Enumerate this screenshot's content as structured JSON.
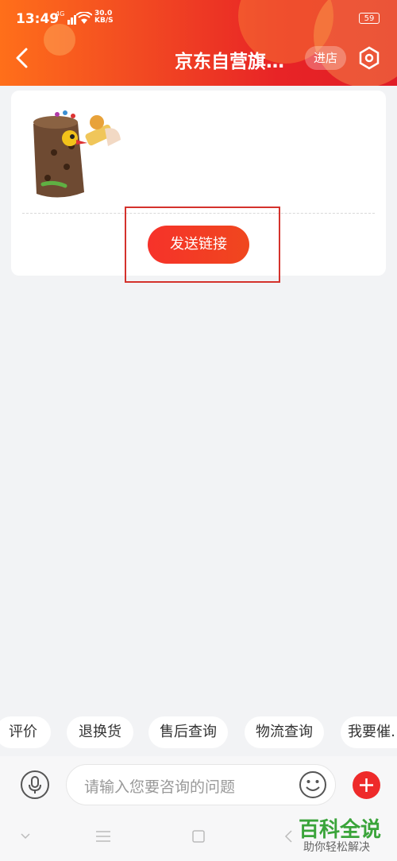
{
  "status": {
    "time": "13:49",
    "network": "4G",
    "speed_value": "30.0",
    "speed_unit": "KB/S",
    "battery": "59"
  },
  "nav": {
    "title": "京东自营旗…",
    "store_label": "进店"
  },
  "card": {
    "send_label": "发送链接"
  },
  "quick_replies": [
    "评价",
    "退换货",
    "售后查询",
    "物流查询",
    "我要催…"
  ],
  "input": {
    "placeholder": "请输入您要咨询的问题"
  },
  "watermark": {
    "main": "百科全说",
    "sub": "助你轻松解决"
  },
  "colors": {
    "brand_red": "#e82426",
    "accent_orange": "#ff6f1a",
    "watermark_green": "#3aa43a"
  }
}
